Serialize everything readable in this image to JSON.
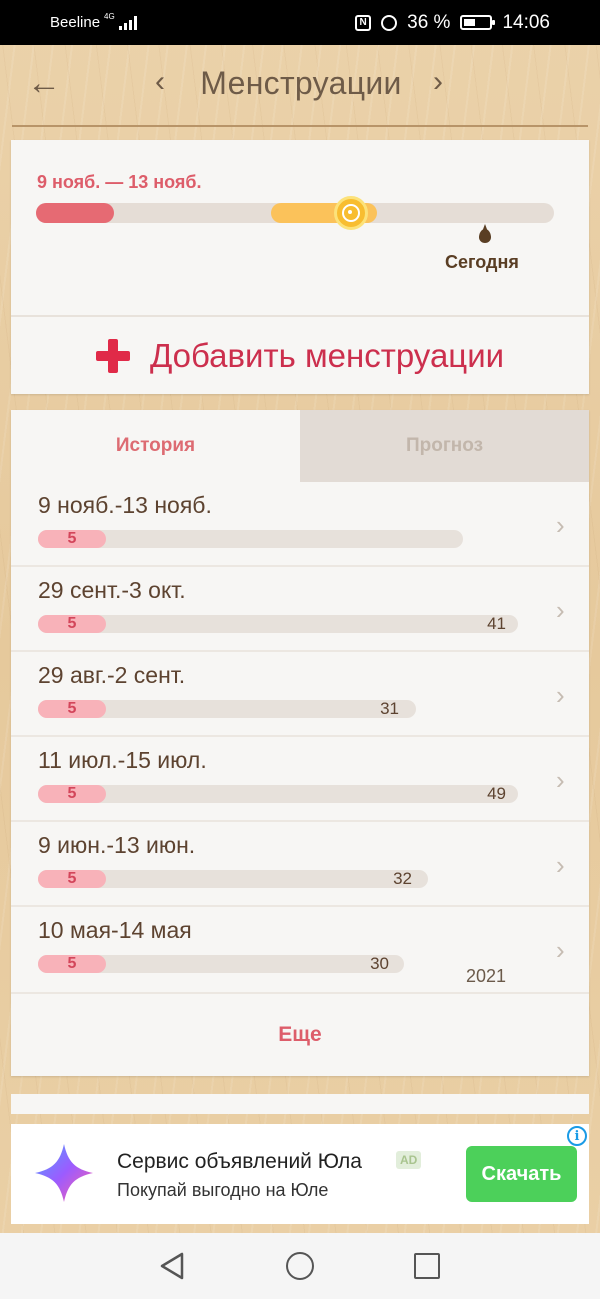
{
  "status": {
    "carrier": "Beeline",
    "network": "4G",
    "battery": "36 %",
    "time": "14:06"
  },
  "header": {
    "title": "Менструации",
    "back_icon": "back-arrow-icon",
    "prev_icon": "chevron-left-icon",
    "next_icon": "chevron-right-icon"
  },
  "current_cycle": {
    "range": "9 нояб. — 13 нояб.",
    "today_label": "Сегодня"
  },
  "add_action": {
    "label": "Добавить менструации"
  },
  "tabs": [
    {
      "label": "История",
      "active": true
    },
    {
      "label": "Прогноз",
      "active": false
    }
  ],
  "history": [
    {
      "date": "9 нояб.-13 нояб.",
      "period_days": "5",
      "cycle_days": ""
    },
    {
      "date": "29 сент.-3 окт.",
      "period_days": "5",
      "cycle_days": "41"
    },
    {
      "date": "29 авг.-2 сент.",
      "period_days": "5",
      "cycle_days": "31"
    },
    {
      "date": "11 июл.-15 июл.",
      "period_days": "5",
      "cycle_days": "49"
    },
    {
      "date": "9 июн.-13 июн.",
      "period_days": "5",
      "cycle_days": "32"
    },
    {
      "date": "10 мая-14 мая",
      "period_days": "5",
      "cycle_days": "30"
    }
  ],
  "year_label": "2021",
  "more_label": "Еще",
  "ad": {
    "title": "Сервис объявлений Юла",
    "badge": "AD",
    "subtitle": "Покупай выгодно на Юле",
    "button": "Скачать",
    "info": "i"
  },
  "colors": {
    "accent_red": "#dd5d6a",
    "period_red": "#e66a73",
    "fertile_yellow": "#fbc25a",
    "ad_button_green": "#4cd05a"
  }
}
